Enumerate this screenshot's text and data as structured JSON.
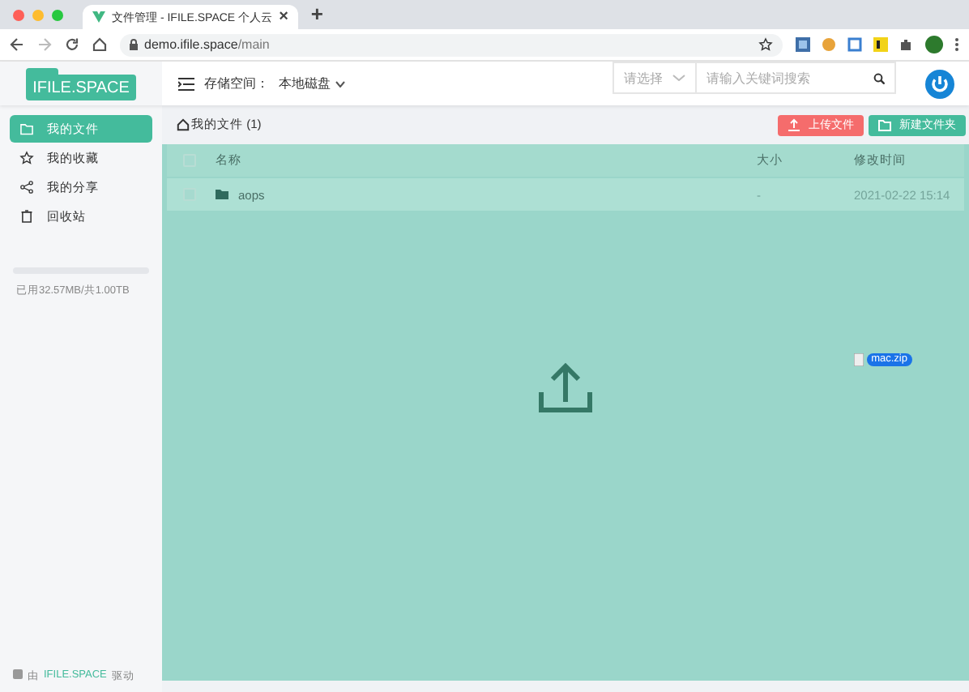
{
  "browser": {
    "tab_title": "文件管理 - IFILE.SPACE 个人云",
    "new_tab": "+",
    "close_tab": "×",
    "url_host": "demo.ifile.space",
    "url_path": "/main"
  },
  "header": {
    "logo": "IFILE.SPACE",
    "storage_label": "存储空间：",
    "storage_value": "本地磁盘",
    "select_placeholder": "请选择",
    "search_placeholder": "请输入关键词搜索"
  },
  "sidebar": {
    "items": [
      {
        "label": "我的文件",
        "kind": "folder",
        "selected": true
      },
      {
        "label": "我的收藏",
        "kind": "star",
        "selected": false
      },
      {
        "label": "我的分享",
        "kind": "share",
        "selected": false
      },
      {
        "label": "回收站",
        "kind": "trash",
        "selected": false
      }
    ],
    "storage": {
      "level": 0.0,
      "text": "已用32.57MB/共1.00TB"
    },
    "footer": {
      "prefix": "由",
      "brand": "IFILE.SPACE",
      "suffix": "驱动"
    }
  },
  "toolbar": {
    "breadcrumb": "我的文件 (1)",
    "buttons": [
      {
        "label": "上传文件",
        "kind": "upload"
      },
      {
        "label": "新建文件夹",
        "kind": "new-folder"
      }
    ]
  },
  "table": {
    "all_checked": false,
    "columns": [
      "名称",
      "大小",
      "修改时间"
    ],
    "rows": [
      {
        "name": "aops",
        "size": "-",
        "modified": "2021-02-22 15:14",
        "checked": false
      }
    ]
  },
  "drop": {
    "active": true,
    "dragged_file": "mac.zip"
  }
}
